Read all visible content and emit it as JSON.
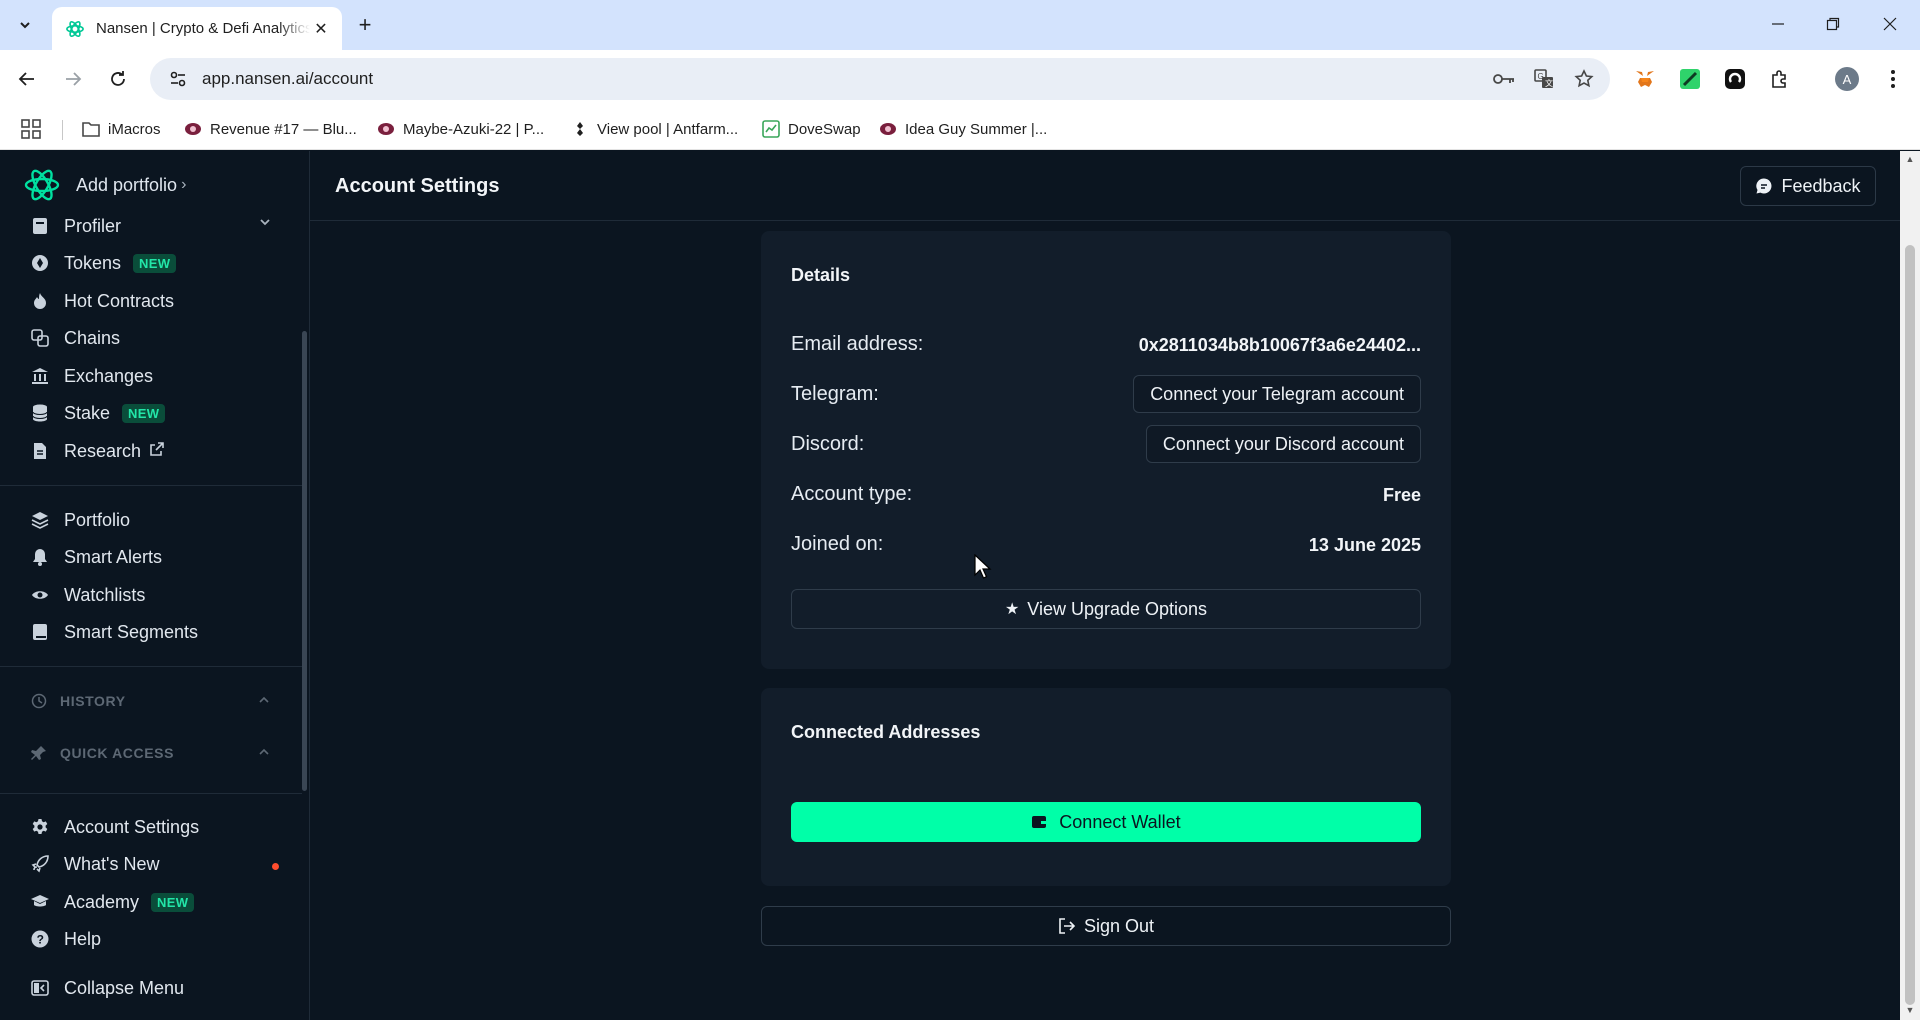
{
  "browser": {
    "tab_title": "Nansen | Crypto & Defi Analytics",
    "url": "app.nansen.ai/account",
    "bookmarks": [
      {
        "label": "iMacros",
        "icon": "folder-icon"
      },
      {
        "label": "Revenue #17 — Blu...",
        "icon": "site-favicon"
      },
      {
        "label": "Maybe-Azuki-22 | P...",
        "icon": "site-favicon"
      },
      {
        "label": "View pool | Antfarm...",
        "icon": "site-favicon"
      },
      {
        "label": "DoveSwap",
        "icon": "site-favicon"
      },
      {
        "label": "Idea Guy Summer |...",
        "icon": "site-favicon"
      }
    ],
    "profile_initial": "A"
  },
  "sidebar": {
    "add_portfolio": "Add portfolio",
    "group1": [
      {
        "label": "Profiler",
        "icon": "profiler-icon",
        "badge": "",
        "caret": true
      },
      {
        "label": "Tokens",
        "icon": "token-icon",
        "badge": "NEW"
      },
      {
        "label": "Hot Contracts",
        "icon": "flame-icon",
        "badge": ""
      },
      {
        "label": "Chains",
        "icon": "chains-icon",
        "badge": ""
      },
      {
        "label": "Exchanges",
        "icon": "bank-icon",
        "badge": ""
      },
      {
        "label": "Stake",
        "icon": "database-icon",
        "badge": "NEW"
      },
      {
        "label": "Research",
        "icon": "document-icon",
        "badge": ""
      }
    ],
    "group2": [
      {
        "label": "Portfolio",
        "icon": "layers-icon"
      },
      {
        "label": "Smart Alerts",
        "icon": "bell-icon"
      },
      {
        "label": "Watchlists",
        "icon": "eye-icon"
      },
      {
        "label": "Smart Segments",
        "icon": "book-icon"
      }
    ],
    "history": "HISTORY",
    "quick_access": "QUICK ACCESS",
    "group3": [
      {
        "label": "Account Settings",
        "icon": "gear-icon",
        "badge": ""
      },
      {
        "label": "What's New",
        "icon": "rocket-icon",
        "badge": ""
      },
      {
        "label": "Academy",
        "icon": "graduation-icon",
        "badge": "NEW"
      },
      {
        "label": "Help",
        "icon": "help-icon",
        "badge": ""
      }
    ],
    "collapse": "Collapse Menu"
  },
  "header": {
    "title": "Account Settings",
    "feedback": "Feedback"
  },
  "details": {
    "title": "Details",
    "email_label": "Email address:",
    "email_value": "0x2811034b8b10067f3a6e24402...",
    "telegram_label": "Telegram:",
    "telegram_button": "Connect your Telegram account",
    "discord_label": "Discord:",
    "discord_button": "Connect your Discord account",
    "account_type_label": "Account type:",
    "account_type_value": "Free",
    "joined_label": "Joined on:",
    "joined_value": "13 June 2025",
    "upgrade_button": "View Upgrade Options"
  },
  "connected": {
    "title": "Connected Addresses",
    "wallet_button": "Connect Wallet"
  },
  "signout": "Sign Out",
  "colors": {
    "accent": "#00ffa8",
    "background": "#0b1520",
    "card": "#121d2a",
    "badge_bg": "#0a4d3a",
    "badge_text": "#22e6a8",
    "notification_dot": "#ff4d2e"
  }
}
